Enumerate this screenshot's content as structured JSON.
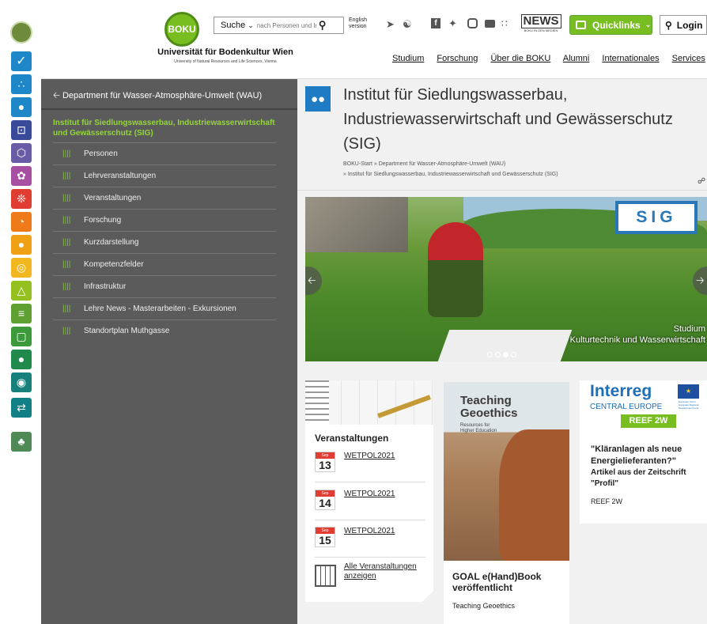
{
  "header": {
    "logo_text": "BOKU",
    "uni_name": "Universität für Bodenkultur Wien",
    "uni_sub": "University of Natural Resources and Life Sciences, Vienna",
    "search_scope": "Suche",
    "search_placeholder": "nach Personen und In",
    "english_line1": "English",
    "english_line2": "version",
    "news_logo": "NEWS",
    "news_sub": "BOKU IN DEN MEDIEN",
    "quicklinks": "Quicklinks",
    "login": "Login",
    "nav": [
      "Studium",
      "Forschung",
      "Über die BOKU",
      "Alumni",
      "Internationales",
      "Services"
    ]
  },
  "sidebar": {
    "back_label": "Department für Wasser-Atmosphäre-Umwelt (WAU)",
    "current": "Institut für Siedlungswasserbau, Industriewasserwirtschaft und Gewässerschutz (SIG)",
    "items": [
      "Personen",
      "Lehrveranstaltungen",
      "Veranstaltungen",
      "Forschung",
      "Kurzdarstellung",
      "Kompetenzfelder",
      "Infrastruktur",
      "Lehre News - Masterarbeiten - Exkursionen",
      "Standortplan Muthgasse"
    ]
  },
  "page": {
    "title": "Institut für Siedlungswasserbau, Industriewasserwirtschaft und Gewässerschutz (SIG)",
    "breadcrumb1": "BOKU-Start » Department für Wasser-Atmosphäre-Umwelt (WAU)",
    "breadcrumb2": "» Institut für Siedlungswasserbau, Industriewasserwirtschaft und Gewässerschutz (SIG)"
  },
  "slider": {
    "badge": "SIG",
    "caption1": "Studium",
    "caption2": "Kulturtechnik und Wasserwirtschaft"
  },
  "events": {
    "heading": "Veranstaltungen",
    "month": "Sep",
    "items": [
      {
        "day": "13",
        "title": "WETPOL2021"
      },
      {
        "day": "14",
        "title": "WETPOL2021"
      },
      {
        "day": "15",
        "title": "WETPOL2021"
      }
    ],
    "all_label": "Alle Veranstaltungen anzeigen"
  },
  "geoethics": {
    "img_title1": "Teaching",
    "img_title2": "Geoethics",
    "img_sub1": "Resources for",
    "img_sub2": "Higher Education",
    "title": "GOAL e(Hand)Book veröffentlicht",
    "sub": "Teaching Geoethics"
  },
  "interreg": {
    "logo": "Interreg",
    "region": "CENTRAL EUROPE",
    "eu_text1": "European Union",
    "eu_text2": "European Regional",
    "eu_text3": "Development Fund",
    "project": "REEF 2W",
    "quote": "\"Kläranlagen als neue Energielieferanten?\"",
    "article": "Artikel aus der Zeitschrift \"Profil\"",
    "tag": "REEF 2W"
  },
  "colors": {
    "green": "#78be20",
    "dark_green": "#2e6b1f",
    "sidebar_bg": "#5b5b5b",
    "accent_blue": "#1e7bc4",
    "rail": [
      "#6e8a3b",
      "#1d87c8",
      "#1d87c8",
      "#1d87c8",
      "#3a4a9a",
      "#6a5ba6",
      "#a74fa3",
      "#e03c31",
      "#ef7a1a",
      "#f0a015",
      "#f2b61e",
      "#94c11f",
      "#5ea032",
      "#3d9a3b",
      "#1f8a4c",
      "#18807a",
      "#118086",
      "#4f8a56"
    ]
  }
}
